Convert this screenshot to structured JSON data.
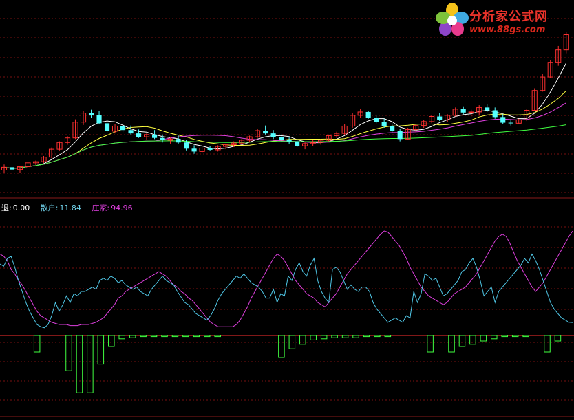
{
  "logo": {
    "title": "分析家公式网",
    "url": "www.88gs.com"
  },
  "legend": [
    {
      "label": "退:",
      "value": "0.00",
      "color": "#ffffff"
    },
    {
      "label": "散户:",
      "value": "11.84",
      "color": "#6fd0e8"
    },
    {
      "label": "庄家:",
      "value": "94.96",
      "color": "#e040e0"
    }
  ],
  "colors": {
    "background": "#000000",
    "grid": "#7a1010",
    "up_candle": "#ff3030",
    "down_candle": "#54ffff",
    "ma_short": "#ffffff",
    "ma_mid": "#ffff40",
    "ma_long": "#e040e0",
    "ma_longest": "#40ff40",
    "retail_line": "#50c8e8",
    "dealer_line": "#e040e0",
    "histogram": "#40ff40",
    "zero_line": "#ff3030"
  },
  "chart_data": [
    {
      "type": "candlestick",
      "series": [
        {
          "name": "",
          "kind": "candles",
          "ohlc": [
            [
              84.5,
              85.5,
              84.0,
              85.0
            ],
            [
              85.0,
              85.4,
              84.3,
              84.6
            ],
            [
              84.6,
              85.2,
              84.0,
              85.1
            ],
            [
              85.1,
              86.0,
              84.8,
              85.8
            ],
            [
              85.8,
              86.2,
              85.4,
              86.0
            ],
            [
              86.0,
              87.0,
              85.8,
              86.8
            ],
            [
              86.8,
              88.5,
              86.6,
              88.2
            ],
            [
              88.2,
              89.6,
              88.0,
              89.4
            ],
            [
              89.4,
              90.5,
              89.0,
              90.2
            ],
            [
              90.2,
              93.5,
              90.0,
              93.0
            ],
            [
              93.0,
              95.0,
              92.5,
              94.6
            ],
            [
              94.6,
              95.2,
              93.8,
              94.2
            ],
            [
              94.2,
              95.0,
              92.6,
              92.8
            ],
            [
              92.8,
              93.5,
              91.0,
              91.4
            ],
            [
              91.4,
              92.6,
              91.0,
              92.3
            ],
            [
              92.3,
              92.8,
              91.2,
              91.6
            ],
            [
              91.6,
              92.4,
              90.8,
              91.0
            ],
            [
              91.0,
              91.7,
              90.2,
              90.4
            ],
            [
              90.4,
              91.0,
              89.8,
              90.8
            ],
            [
              90.8,
              91.6,
              90.0,
              90.2
            ],
            [
              90.2,
              90.8,
              89.4,
              89.8
            ],
            [
              89.8,
              90.4,
              89.2,
              90.0
            ],
            [
              90.0,
              90.6,
              89.2,
              89.4
            ],
            [
              89.4,
              89.8,
              88.0,
              88.3
            ],
            [
              88.3,
              88.9,
              87.4,
              87.8
            ],
            [
              87.8,
              88.6,
              87.6,
              88.4
            ],
            [
              88.4,
              88.8,
              87.9,
              88.1
            ],
            [
              88.1,
              88.9,
              87.8,
              88.7
            ],
            [
              88.7,
              89.2,
              88.2,
              89.0
            ],
            [
              89.0,
              89.6,
              88.6,
              89.3
            ],
            [
              89.3,
              90.0,
              89.0,
              89.8
            ],
            [
              89.8,
              90.6,
              89.4,
              90.4
            ],
            [
              90.4,
              91.8,
              90.2,
              91.5
            ],
            [
              91.5,
              92.4,
              90.8,
              91.0
            ],
            [
              91.0,
              91.6,
              90.0,
              90.3
            ],
            [
              90.3,
              90.9,
              89.6,
              89.8
            ],
            [
              89.8,
              90.4,
              89.2,
              89.6
            ],
            [
              89.6,
              90.0,
              88.6,
              88.8
            ],
            [
              88.8,
              89.4,
              88.2,
              89.2
            ],
            [
              89.2,
              89.8,
              88.8,
              89.4
            ],
            [
              89.4,
              90.0,
              89.0,
              89.8
            ],
            [
              89.8,
              90.8,
              89.6,
              90.6
            ],
            [
              90.6,
              91.3,
              90.2,
              91.0
            ],
            [
              91.0,
              92.6,
              90.8,
              92.3
            ],
            [
              92.3,
              94.6,
              92.0,
              94.2
            ],
            [
              94.2,
              95.4,
              93.8,
              94.8
            ],
            [
              94.8,
              95.0,
              93.6,
              93.8
            ],
            [
              93.8,
              94.3,
              92.8,
              93.0
            ],
            [
              93.0,
              93.6,
              92.0,
              92.3
            ],
            [
              92.3,
              92.8,
              91.2,
              91.5
            ],
            [
              91.5,
              91.8,
              89.6,
              90.0
            ],
            [
              90.0,
              92.0,
              89.8,
              91.7
            ],
            [
              91.7,
              92.7,
              91.3,
              92.4
            ],
            [
              92.4,
              93.4,
              92.0,
              93.1
            ],
            [
              93.1,
              94.2,
              92.8,
              94.0
            ],
            [
              94.0,
              94.6,
              93.2,
              93.4
            ],
            [
              93.4,
              94.4,
              93.0,
              94.2
            ],
            [
              94.2,
              95.6,
              94.0,
              95.3
            ],
            [
              95.3,
              95.8,
              94.4,
              94.7
            ],
            [
              94.7,
              95.2,
              94.0,
              94.8
            ],
            [
              94.8,
              96.0,
              94.3,
              95.6
            ],
            [
              95.6,
              96.2,
              94.8,
              95.1
            ],
            [
              95.1,
              95.6,
              93.6,
              93.9
            ],
            [
              93.9,
              94.4,
              92.6,
              92.9
            ],
            [
              92.9,
              93.4,
              92.4,
              92.8
            ],
            [
              92.8,
              93.6,
              92.6,
              93.4
            ],
            [
              93.4,
              95.4,
              93.2,
              95.1
            ],
            [
              95.1,
              99.0,
              95.0,
              98.6
            ],
            [
              98.6,
              101.5,
              98.4,
              101.0
            ],
            [
              101.0,
              104.0,
              100.8,
              103.6
            ],
            [
              103.6,
              106.5,
              103.0,
              105.8
            ],
            [
              105.8,
              109.0,
              105.2,
              108.5
            ]
          ]
        },
        {
          "name": "",
          "kind": "ma",
          "period": 5
        },
        {
          "name": "",
          "kind": "ma",
          "period": 10
        },
        {
          "name": "",
          "kind": "ma",
          "period": 20
        },
        {
          "name": "",
          "kind": "ma",
          "period": 60
        }
      ]
    },
    {
      "type": "line",
      "series": [
        {
          "name": "散户",
          "values": [
            65,
            63,
            70,
            72,
            62,
            50,
            40,
            30,
            22,
            16,
            10,
            8,
            7,
            10,
            18,
            30,
            22,
            28,
            36,
            30,
            38,
            36,
            40,
            40,
            42,
            44,
            42,
            50,
            52,
            50,
            54,
            52,
            48,
            50,
            46,
            44,
            42,
            44,
            40,
            38,
            36,
            42,
            46,
            50,
            54,
            50,
            48,
            46,
            40,
            35,
            30,
            28,
            24,
            20,
            18,
            16,
            14,
            18,
            24,
            32,
            38,
            42,
            46,
            50,
            54,
            52,
            56,
            52,
            48,
            46,
            44,
            40,
            34,
            34,
            42,
            30,
            38,
            36,
            54,
            50,
            60,
            66,
            58,
            54,
            64,
            70,
            50,
            40,
            34,
            30,
            60,
            62,
            58,
            50,
            42,
            46,
            42,
            40,
            44,
            44,
            40,
            30,
            24,
            20,
            16,
            12,
            14,
            16,
            14,
            12,
            18,
            16,
            40,
            30,
            38,
            56,
            54,
            50,
            52,
            44,
            36,
            38,
            42,
            46,
            50,
            58,
            60,
            66,
            70,
            62,
            50,
            36,
            40,
            44,
            30,
            40,
            44,
            48,
            52,
            56,
            60,
            64,
            70,
            66,
            74,
            68,
            60,
            50,
            40,
            30,
            24,
            20,
            16,
            14,
            12,
            11.84
          ]
        },
        {
          "name": "庄家",
          "values": [
            74,
            72,
            68,
            60,
            56,
            50,
            46,
            40,
            34,
            28,
            22,
            18,
            16,
            14,
            12,
            11,
            10,
            10,
            10,
            9,
            9,
            9,
            10,
            10,
            10,
            11,
            12,
            14,
            16,
            20,
            24,
            28,
            34,
            36,
            40,
            42,
            44,
            46,
            48,
            50,
            52,
            54,
            56,
            58,
            56,
            54,
            50,
            46,
            44,
            40,
            38,
            34,
            32,
            28,
            24,
            20,
            16,
            12,
            10,
            8,
            8,
            8,
            8,
            8,
            10,
            14,
            20,
            26,
            34,
            40,
            46,
            52,
            58,
            64,
            70,
            74,
            72,
            68,
            62,
            56,
            50,
            46,
            42,
            38,
            36,
            34,
            30,
            28,
            26,
            30,
            34,
            38,
            44,
            50,
            56,
            60,
            64,
            68,
            72,
            76,
            80,
            84,
            88,
            92,
            95,
            94,
            90,
            86,
            82,
            76,
            70,
            62,
            56,
            50,
            44,
            40,
            36,
            34,
            32,
            30,
            28,
            30,
            34,
            38,
            40,
            42,
            44,
            48,
            52,
            56,
            62,
            68,
            74,
            80,
            86,
            90,
            92,
            90,
            84,
            76,
            68,
            62,
            56,
            50,
            44,
            40,
            44,
            48,
            54,
            60,
            66,
            72,
            78,
            84,
            90,
            94.96
          ]
        },
        {
          "name": "退",
          "values": [
            0,
            0,
            0,
            -15,
            0,
            0,
            -32,
            -52,
            -52,
            -26,
            -10,
            -3,
            -2,
            -1,
            -1,
            -1,
            -1,
            -1,
            -1,
            -1,
            -1,
            0,
            0,
            0,
            0,
            0,
            -20,
            -12,
            -8,
            -4,
            -3,
            -2,
            -2,
            -2,
            -1,
            -1,
            -1,
            0,
            0,
            0,
            -15,
            0,
            -15,
            -10,
            -8,
            -5,
            -3,
            -1,
            -1,
            -1,
            0,
            -15,
            -5,
            0
          ]
        }
      ],
      "ylim": [
        -70,
        110
      ],
      "zero_line": true
    }
  ]
}
